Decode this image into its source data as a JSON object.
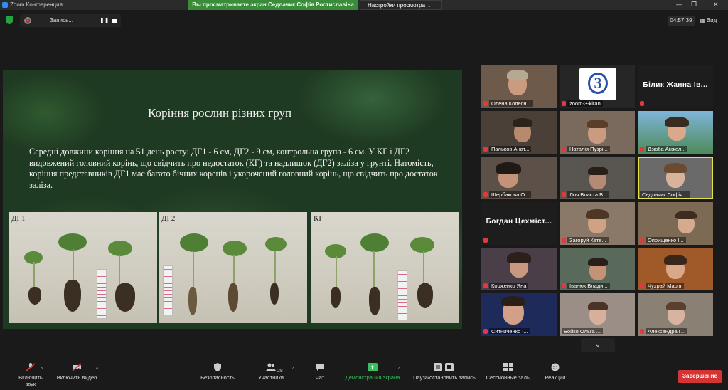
{
  "window": {
    "title": "Zoom Конференция",
    "view_banner": "Вы просматриваете экран Седлачик Софія Ростиславіна",
    "view_options": "Настройки просмотра ⌄",
    "min": "—",
    "max": "❐",
    "close": "✕"
  },
  "recording": {
    "label": "Запись...",
    "pause": "❚❚"
  },
  "meeting": {
    "timer": "04:57:39",
    "view_label": "Вид"
  },
  "slide": {
    "title": "Коріння рослин різних груп",
    "body": "Середні довжини коріння на 51 день росту: ДГ1 - 6 см, ДГ2 - 9 см, контрольна група - 6 см. У КГ і ДГ2 видовжений головний корінь, що свідчить про недостаток (КГ) та надлишок (ДГ2) заліза у грунті. Натомість, коріння представників ДГ1 має багато бічних коренів і укорочений головний корінь, що свідчить про достаток заліза.",
    "photos": [
      {
        "label": "ДГ1"
      },
      {
        "label": "ДГ2"
      },
      {
        "label": "КГ"
      }
    ]
  },
  "participants": [
    {
      "name": "Олена Колесн...",
      "kind": "video"
    },
    {
      "name": "zoom-3-kiran",
      "kind": "logo"
    },
    {
      "name": "Білик Жанна Ів...",
      "kind": "text"
    },
    {
      "name": "Пальков Анат...",
      "kind": "video"
    },
    {
      "name": "Наталія Пузрі...",
      "kind": "video"
    },
    {
      "name": "Дзюба Анжел...",
      "kind": "video"
    },
    {
      "name": "Щербакова О...",
      "kind": "video"
    },
    {
      "name": "Лоя Власта В...",
      "kind": "video"
    },
    {
      "name": "Седлачик Софія ...",
      "kind": "video",
      "active": true
    },
    {
      "name": "Богдан Цехміст...",
      "kind": "text"
    },
    {
      "name": "Загоруй Кате...",
      "kind": "video"
    },
    {
      "name": "Оприщенко І...",
      "kind": "video"
    },
    {
      "name": "Корженко Яна",
      "kind": "video"
    },
    {
      "name": "Іванюк Влади...",
      "kind": "video"
    },
    {
      "name": "Чухрай Марія",
      "kind": "video"
    },
    {
      "name": "Ситниченко І...",
      "kind": "video"
    },
    {
      "name": "Бойко Ольга ...",
      "kind": "video"
    },
    {
      "name": "Александра Г...",
      "kind": "video"
    }
  ],
  "logo_tile": {
    "digit": "3"
  },
  "pager": {
    "down": "⌄"
  },
  "toolbar": {
    "mute": "Включить звук",
    "video": "Включить видео",
    "security": "Безопасность",
    "participants": "Участники",
    "participants_count": "28",
    "chat": "Чат",
    "share": "Демонстрация экрана",
    "pause_rec": "Пауза/остановить запись",
    "breakout": "Сессионные залы",
    "reactions": "Реакции",
    "end": "Завершение",
    "caret": "^"
  },
  "colors": {
    "accent": "#37c15b",
    "end": "#d63434",
    "banner": "#3a8b3a",
    "active_outline": "#e8e24a"
  }
}
